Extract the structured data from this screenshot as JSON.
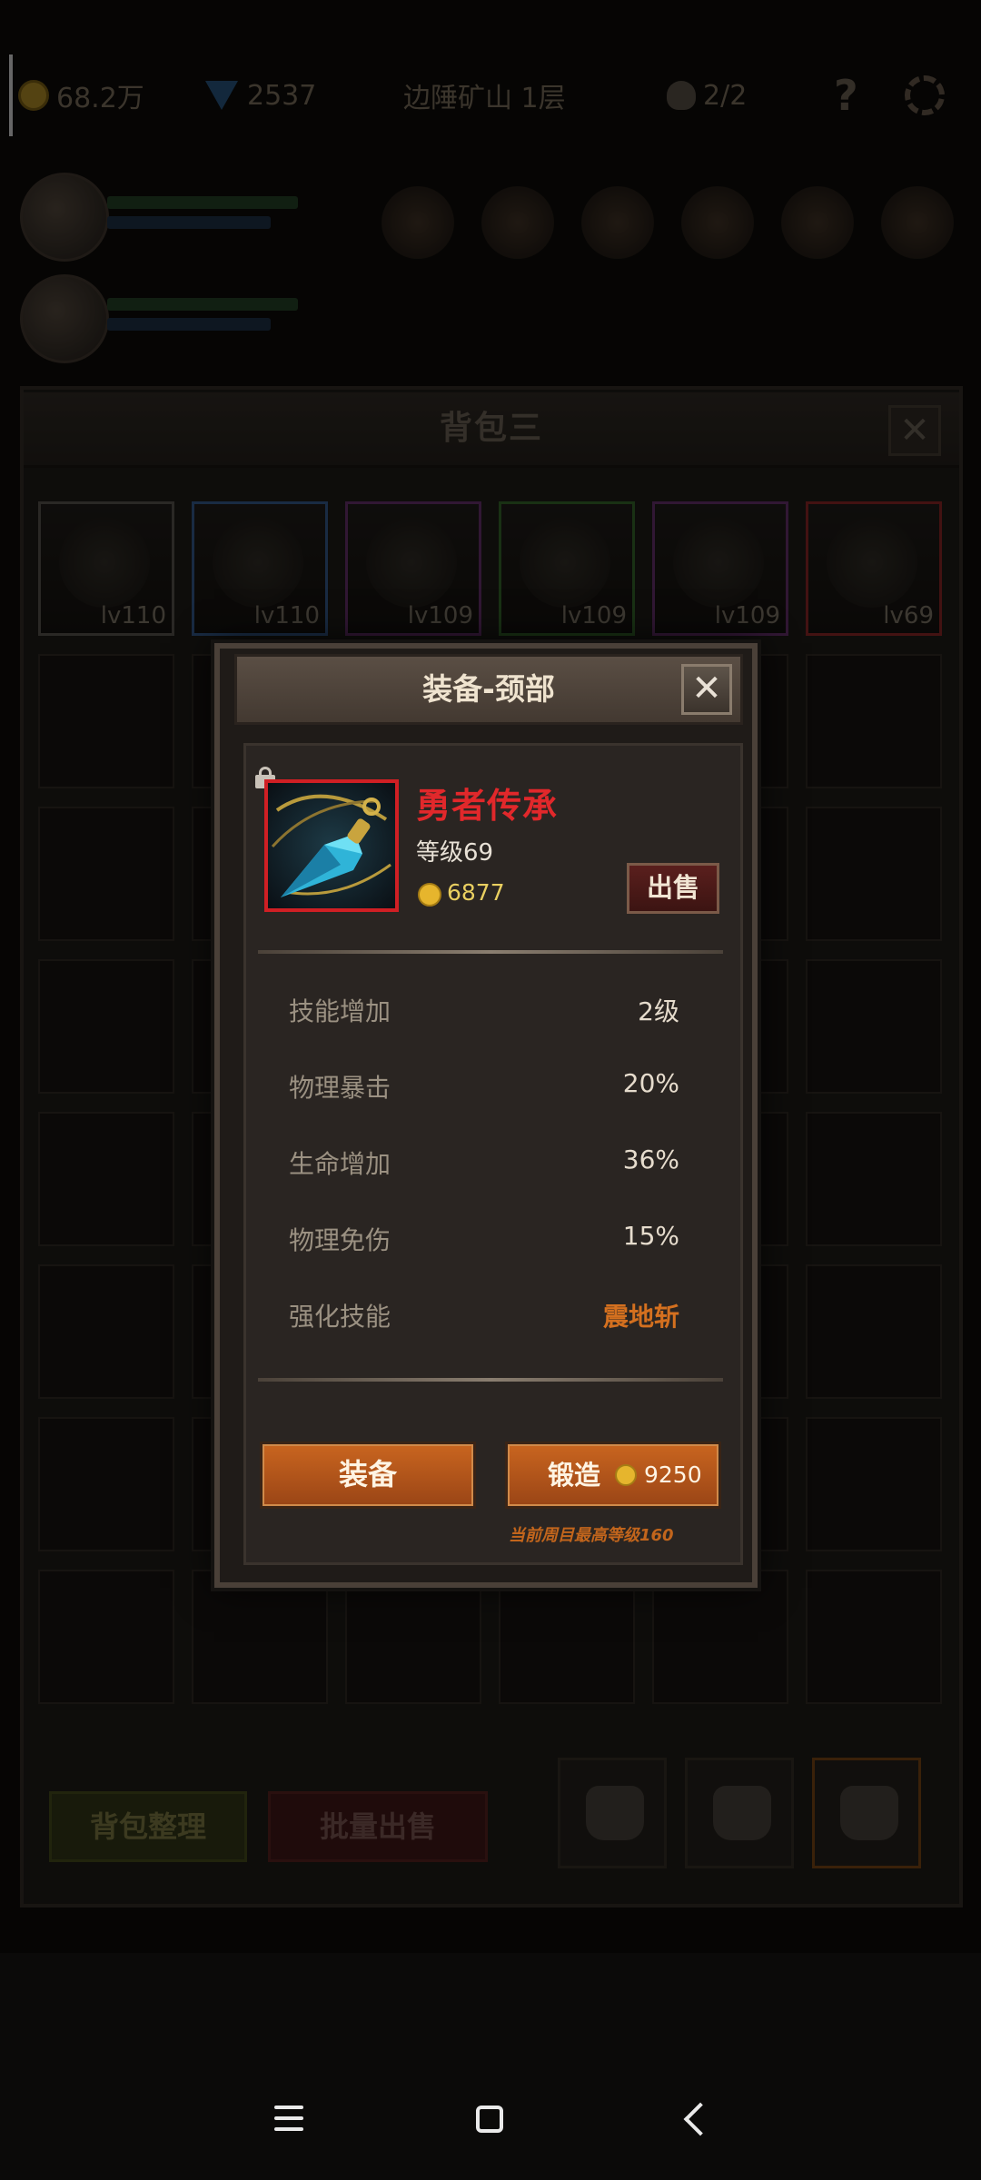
{
  "hud": {
    "gold": "68.2万",
    "gems": "2537",
    "location": "边陲矿山 1层",
    "skull_count": "2/2",
    "help": "?"
  },
  "backpack": {
    "title": "背包三",
    "close": "✕",
    "items": [
      {
        "level": "lv110",
        "border": "#4d4a44",
        "icon": "scythe-icon"
      },
      {
        "level": "lv110",
        "border": "#2f4f7a",
        "icon": "ring-icon"
      },
      {
        "level": "lv109",
        "border": "#5a2a5f",
        "icon": "scythe-icon"
      },
      {
        "level": "lv109",
        "border": "#2f5a25",
        "icon": "wing-shoulder-icon"
      },
      {
        "level": "lv109",
        "border": "#5a2a5f",
        "icon": "amulet-icon"
      },
      {
        "level": "lv69",
        "border": "#7a2222",
        "icon": "pendant-icon"
      }
    ],
    "sort_button": "背包整理",
    "bulk_sell_button": "批量出售"
  },
  "dialog": {
    "title": "装备-颈部",
    "close": "✕",
    "item": {
      "name": "勇者传承",
      "level": "等级69",
      "price": "6877",
      "sell_button": "出售",
      "icon": "pendant-icon",
      "name_color": "#e1282b"
    },
    "stats": [
      {
        "label": "技能增加",
        "value": "2级"
      },
      {
        "label": "物理暴击",
        "value": "20%"
      },
      {
        "label": "生命增加",
        "value": "36%"
      },
      {
        "label": "物理免伤",
        "value": "15%"
      },
      {
        "label": "强化技能",
        "value": "震地斩"
      }
    ],
    "equip_button": "装备",
    "forge_button": "锻造",
    "forge_cost": "9250",
    "forge_note": "当前周目最高等级160"
  }
}
